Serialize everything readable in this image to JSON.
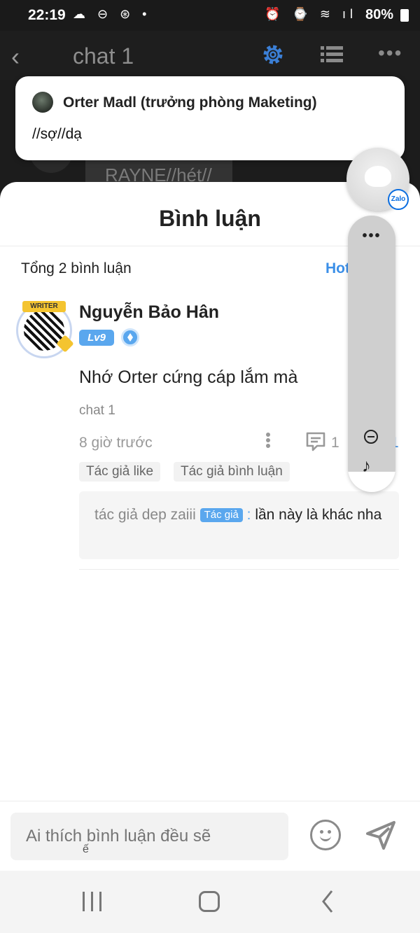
{
  "status_bar": {
    "time": "22:19",
    "left_icons": "☁ ⊖ ⊛ •",
    "right_icons": "⏰ ⌚ ≋ ıl",
    "battery": "80%"
  },
  "chat": {
    "title": "chat 1",
    "background_message": "RAYNE//hét//"
  },
  "notification": {
    "sender": "Orter Madl (trưởng phòng Maketing)",
    "message": "//sợ//dạ"
  },
  "comments_sheet": {
    "title": "Bình luận",
    "total": "Tổng 2 bình luận",
    "sort": "Hot  ại",
    "comment": {
      "author": "Nguyễn Bảo Hân",
      "level": "Lv9",
      "avatar_badge": "WRITER",
      "text": "Nhớ Orter cứng cáp lắm mà",
      "source": "chat 1",
      "time": "8 giờ trước",
      "reply_count": "1",
      "like_count": "1",
      "chips": [
        "Tác giả like",
        "Tác giả bình luận"
      ],
      "reply": {
        "author": "tác giả dep zaiii",
        "tag": "Tác giả",
        "separator": " : ",
        "text": "lần này là khác nha"
      }
    }
  },
  "floating": {
    "badge": "Zalo",
    "menu_dots": "•••",
    "music": "♪"
  },
  "input": {
    "placeholder": "Ai thích bình luận đều sẽ",
    "placeholder_tail": "ế"
  },
  "colors": {
    "accent": "#3b8fe8",
    "level_badge": "#5aa7ee",
    "gear": "#3b7fd6"
  }
}
